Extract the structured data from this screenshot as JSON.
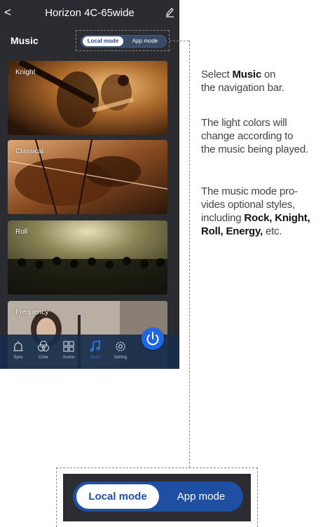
{
  "app": {
    "back_glyph": "<",
    "title": "Horizon 4C-65wide",
    "edit_icon": "pencil-icon"
  },
  "music": {
    "heading": "Music",
    "modes": {
      "local": "Local mode",
      "app": "App mode",
      "selected": "Local mode"
    }
  },
  "cards": [
    {
      "label": "Knight"
    },
    {
      "label": "Classical"
    },
    {
      "label": "Roll"
    },
    {
      "label": "Frequency"
    }
  ],
  "tabs": [
    {
      "label": "Sync",
      "icon": "sync-icon"
    },
    {
      "label": "Color",
      "icon": "color-icon"
    },
    {
      "label": "Scene",
      "icon": "scene-icon"
    },
    {
      "label": "Music",
      "icon": "music-icon",
      "active": true
    },
    {
      "label": "Setting",
      "icon": "setting-icon"
    }
  ],
  "power": {
    "icon": "power-icon"
  },
  "colors": {
    "accent": "#1f67e6",
    "tabbar": "#162c4a",
    "screen_bg": "#2a2c31"
  },
  "description": {
    "p1": {
      "t1": "Select ",
      "b1": "Music",
      "t2": " on",
      "l2": "the navigation bar."
    },
    "p2": {
      "l1": "The light colors will",
      "l2": "change according to",
      "l3": "the music being played."
    },
    "p3": {
      "l1": "The music mode pro-",
      "l2": "vides optional styles,",
      "l3_pre": "including ",
      "l3_b": "Rock, Knight,",
      "l4_b": "Roll, Energy,",
      "l4_post": " etc."
    }
  }
}
